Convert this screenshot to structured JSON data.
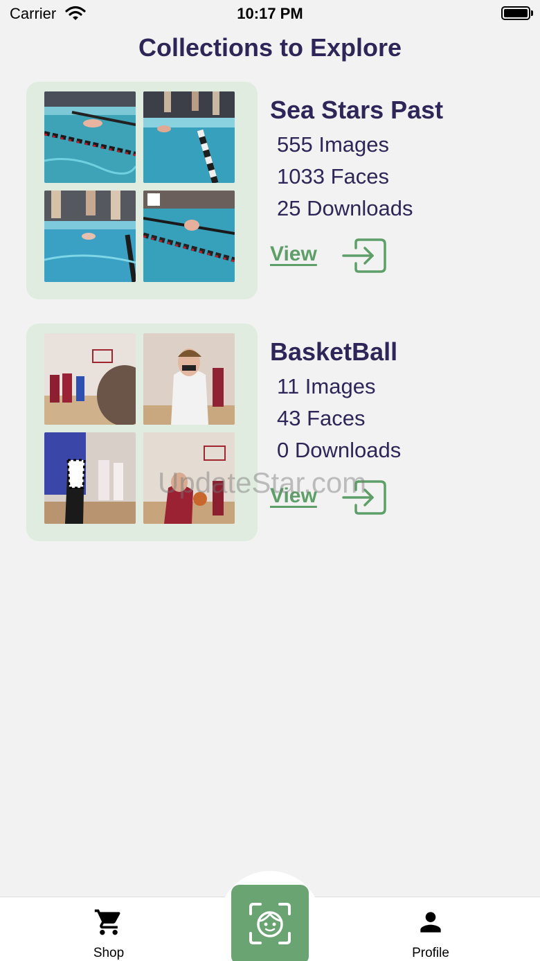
{
  "status_bar": {
    "carrier": "Carrier",
    "time": "10:17 PM"
  },
  "page": {
    "title": "Collections to Explore"
  },
  "collections": [
    {
      "name": "Sea Stars Past",
      "images": "555 Images",
      "faces": "1033 Faces",
      "downloads": "25 Downloads",
      "view_label": "View"
    },
    {
      "name": "BasketBall",
      "images": "11 Images",
      "faces": "43 Faces",
      "downloads": "0 Downloads",
      "view_label": "View"
    }
  ],
  "watermark": "UpdateStar.com",
  "tab_bar": {
    "shop_label": "Shop",
    "profile_label": "Profile",
    "icons": [
      "cart-icon",
      "face-scan-icon",
      "person-icon"
    ]
  },
  "colors": {
    "title": "#2e2558",
    "accent_green": "#6aa472",
    "card_bg": "#e0ecdf",
    "background": "#f2f2f2"
  }
}
